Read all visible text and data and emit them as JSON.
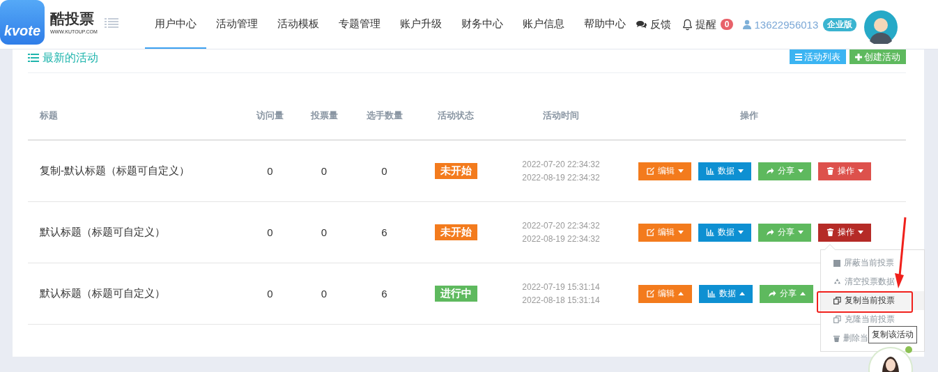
{
  "header": {
    "logo": "kvote",
    "brand": "酷投票",
    "domain": "WWW.KUTOUP.COM",
    "nav": [
      {
        "label": "用户中心",
        "selected": true
      },
      {
        "label": "活动管理",
        "selected": false
      },
      {
        "label": "活动模板",
        "selected": false
      },
      {
        "label": "专题管理",
        "selected": false
      },
      {
        "label": "账户升级",
        "selected": false
      },
      {
        "label": "财务中心",
        "selected": false
      },
      {
        "label": "账户信息",
        "selected": false
      },
      {
        "label": "帮助中心",
        "selected": false
      }
    ],
    "feedback": "反馈",
    "reminder": {
      "label": "提醒",
      "count": "0"
    },
    "user": {
      "phone": "13622956013",
      "plan": "企业版"
    }
  },
  "panel": {
    "title": "最新的活动",
    "buttons": [
      {
        "label": "活动列表",
        "kind": "list"
      },
      {
        "label": "创建活动",
        "kind": "create"
      }
    ]
  },
  "table": {
    "columns": [
      "标题",
      "访问量",
      "投票量",
      "选手数量",
      "活动状态",
      "活动时间",
      "操作"
    ],
    "rows": [
      {
        "title": "复制-默认标题（标题可自定义）",
        "visits": "0",
        "votes": "0",
        "players": "0",
        "status": {
          "label": "未开始",
          "kind": "pending"
        },
        "start": "2022-07-20 22:34:32",
        "end": "2022-08-19 22:34:32",
        "actions": [
          {
            "label": "编辑",
            "kind": "edit",
            "dropup": false,
            "open": false
          },
          {
            "label": "数据",
            "kind": "data",
            "dropup": false,
            "open": false
          },
          {
            "label": "分享",
            "kind": "share",
            "dropup": false,
            "open": false
          },
          {
            "label": "操作",
            "kind": "ops",
            "dropup": false,
            "open": false
          }
        ]
      },
      {
        "title": "默认标题（标题可自定义）",
        "visits": "0",
        "votes": "0",
        "players": "6",
        "status": {
          "label": "未开始",
          "kind": "pending"
        },
        "start": "2022-07-20 22:34:32",
        "end": "2022-08-19 22:34:32",
        "actions": [
          {
            "label": "编辑",
            "kind": "edit",
            "dropup": false,
            "open": false
          },
          {
            "label": "数据",
            "kind": "data",
            "dropup": false,
            "open": false
          },
          {
            "label": "分享",
            "kind": "share",
            "dropup": false,
            "open": false
          },
          {
            "label": "操作",
            "kind": "ops",
            "dropup": false,
            "open": true
          }
        ]
      },
      {
        "title": "默认标题（标题可自定义）",
        "visits": "0",
        "votes": "0",
        "players": "6",
        "status": {
          "label": "进行中",
          "kind": "running"
        },
        "start": "2022-07-19 15:31:14",
        "end": "2022-08-18 15:31:14",
        "actions": [
          {
            "label": "编辑",
            "kind": "edit",
            "dropup": true,
            "open": false
          },
          {
            "label": "数据",
            "kind": "data",
            "dropup": true,
            "open": false
          },
          {
            "label": "分享",
            "kind": "share",
            "dropup": true,
            "open": false
          }
        ]
      }
    ]
  },
  "dropdown": {
    "items": [
      {
        "label": "屏蔽当前投票",
        "kind": "block",
        "selected": false
      },
      {
        "label": "清空投票数据",
        "kind": "clear",
        "selected": false
      },
      {
        "label": "复制当前投票",
        "kind": "copy",
        "selected": true
      },
      {
        "label": "克隆当前投票",
        "kind": "clone",
        "selected": false
      },
      {
        "label": "删除当",
        "kind": "delete",
        "selected": false
      }
    ]
  },
  "tooltip": "复制该活动"
}
